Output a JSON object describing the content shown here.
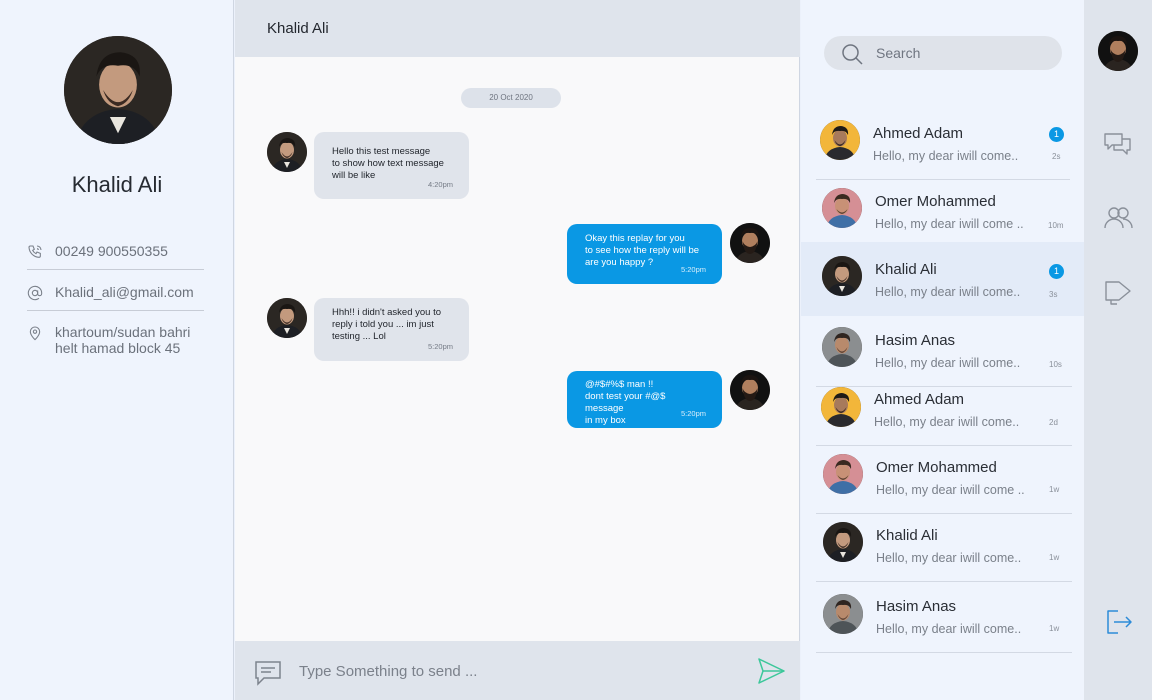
{
  "profile": {
    "name": "Khalid Ali",
    "phone": "00249 900550355",
    "email": "Khalid_ali@gmail.com",
    "address_line1": "khartoum/sudan bahri",
    "address_line2": "helt hamad block 45",
    "icons": {
      "phone": "phone-icon",
      "email": "at-icon",
      "address": "location-pin-icon"
    }
  },
  "chat": {
    "title": "Khalid Ali",
    "date": "20 Oct 2020",
    "messages": [
      {
        "direction": "in",
        "lines": [
          "Hello this test message",
          "to show how text message",
          "will be like"
        ],
        "time": "4:20pm"
      },
      {
        "direction": "out",
        "lines": [
          "Okay this replay for you",
          "to see how the reply will be",
          "are you happy ?"
        ],
        "time": "5:20pm"
      },
      {
        "direction": "in",
        "lines": [
          "Hhh!! i didn't asked you to",
          "reply i told you ... im just",
          "testing ... Lol"
        ],
        "time": "5:20pm"
      },
      {
        "direction": "out",
        "lines": [
          "@#$#%$ man !!",
          "dont test your #@$ message",
          "in my box"
        ],
        "time": "5:20pm"
      }
    ],
    "composer_placeholder": "Type Something to send ...",
    "colors": {
      "outgoing": "#0a98e4",
      "incoming": "#e0e4eb",
      "send_icon": "#3cc79a"
    }
  },
  "contacts": {
    "search_placeholder": "Search",
    "items": [
      {
        "name": "Ahmed Adam",
        "preview": "Hello, my dear iwill come..",
        "time": "2s",
        "badge": "1",
        "avatar": "yellow"
      },
      {
        "name": "Omer Mohammed",
        "preview": "Hello, my dear iwill come ..",
        "time": "10m",
        "badge": "",
        "avatar": "pink"
      },
      {
        "name": "Khalid Ali",
        "preview": "Hello, my dear iwill come..",
        "time": "3s",
        "badge": "1",
        "avatar": "dark",
        "active": true
      },
      {
        "name": "Hasim Anas",
        "preview": "Hello, my dear iwill come..",
        "time": "10s",
        "badge": "",
        "avatar": "grey"
      },
      {
        "name": "Ahmed Adam",
        "preview": "Hello, my dear iwill come..",
        "time": "2d",
        "badge": "",
        "avatar": "yellow"
      },
      {
        "name": "Omer Mohammed",
        "preview": "Hello, my dear iwill come ..",
        "time": "1w",
        "badge": "",
        "avatar": "pink"
      },
      {
        "name": "Khalid Ali",
        "preview": "Hello, my dear iwill come..",
        "time": "1w",
        "badge": "",
        "avatar": "dark"
      },
      {
        "name": "Hasim Anas",
        "preview": "Hello, my dear iwill come..",
        "time": "1w",
        "badge": "",
        "avatar": "grey"
      }
    ]
  },
  "rail": {
    "items": [
      "chats-icon",
      "contacts-icon",
      "announcements-icon",
      "logout-icon"
    ],
    "accent": "#2d8bd8"
  }
}
